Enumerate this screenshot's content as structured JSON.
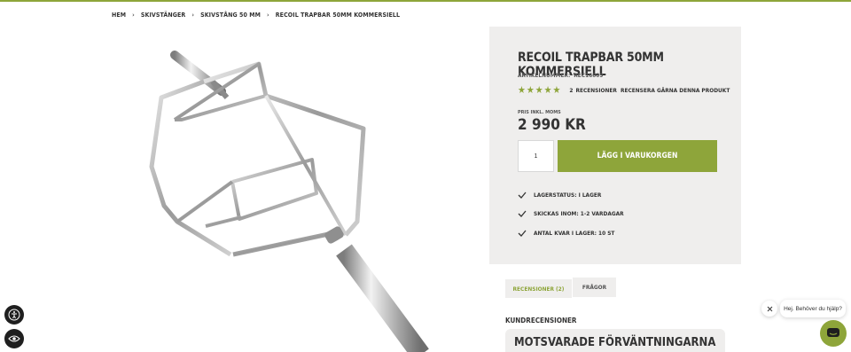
{
  "breadcrumb": {
    "items": [
      "Hem",
      "Skivstänger",
      "Skivstång 50 mm",
      "Recoil Trapbar 50mm Kommersiell"
    ]
  },
  "product": {
    "title": "Recoil Trapbar 50mm Kommersiell",
    "artnr_label": "Artikelnummer:",
    "artnr_value": "REC16009",
    "rating_stars": 5,
    "review_count": "2",
    "review_count_label": "Recensioner",
    "write_review": "Recensera gärna denna produkt",
    "price_label": "Pris inkl. moms",
    "price": "2 990 kr",
    "quantity": "1",
    "add_to_cart": "Lägg i varukorgen",
    "usps": [
      {
        "label": "Lagerstatus:",
        "value": "I lager"
      },
      {
        "label": "Skickas inom:",
        "value": "1-2 vardagar"
      },
      {
        "label": "Antal kvar i lager:",
        "value": "10 st"
      }
    ]
  },
  "tabs": [
    {
      "label": "Recensioner (2)",
      "active": true
    },
    {
      "label": "Frågor",
      "active": false
    }
  ],
  "reviews": {
    "section_title": "Kundrecensioner",
    "first_review_title": "Motsvarade förväntningarna"
  },
  "chat": {
    "greeting": "Hej. Behöver du hjälp?"
  },
  "colors": {
    "accent": "#8ea53a",
    "panel": "#efeeed"
  }
}
